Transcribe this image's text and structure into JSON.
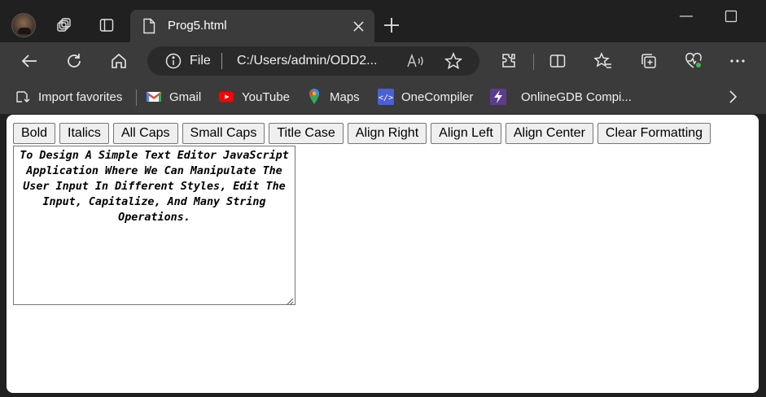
{
  "browser": {
    "tab_title": "Prog5.html",
    "address": {
      "scheme_label": "File",
      "url": "C:/Users/admin/ODD2..."
    },
    "bookmarks": [
      {
        "label": "Import favorites",
        "icon": "import-favorites-icon"
      },
      {
        "label": "Gmail",
        "icon": "gmail-icon"
      },
      {
        "label": "YouTube",
        "icon": "youtube-icon"
      },
      {
        "label": "Maps",
        "icon": "maps-icon"
      },
      {
        "label": "OneCompiler",
        "icon": "onecompiler-icon"
      },
      {
        "label": "OnlineGDB Compi...",
        "icon": "onlinegdb-icon"
      }
    ],
    "colors": {
      "frame": "#202020",
      "toolbar": "#3b3b3b",
      "page": "#ffffff"
    }
  },
  "editor_page": {
    "buttons": [
      {
        "label": "Bold"
      },
      {
        "label": "Italics"
      },
      {
        "label": "All Caps"
      },
      {
        "label": "Small Caps"
      },
      {
        "label": "Title Case"
      },
      {
        "label": "Align Right"
      },
      {
        "label": "Align Left"
      },
      {
        "label": "Align Center"
      },
      {
        "label": "Clear Formatting"
      }
    ],
    "textarea_value": "To Design A Simple Text Editor JavaScript Application Where We Can Manipulate The User Input In Different Styles, Edit The Input, Capitalize, And Many String Operations."
  }
}
